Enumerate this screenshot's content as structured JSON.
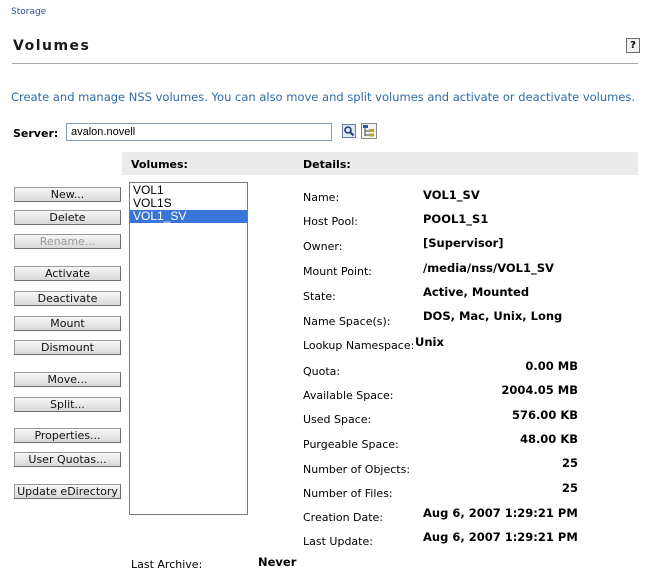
{
  "breadcrumb": "Storage",
  "page_title": "Volumes",
  "help_label": "?",
  "description": "Create and manage NSS volumes. You can also move and split volumes and activate or deactivate volumes.",
  "server": {
    "label": "Server:",
    "value": "avalon.novell"
  },
  "volumes_header": "Volumes:",
  "details_header": "Details:",
  "buttons": {
    "new": "New...",
    "delete": "Delete",
    "rename": "Rename...",
    "activate": "Activate",
    "deactivate": "Deactivate",
    "mount": "Mount",
    "dismount": "Dismount",
    "move": "Move...",
    "split": "Split...",
    "properties": "Properties...",
    "user_quotas": "User Quotas...",
    "update_edirectory": "Update eDirectory"
  },
  "volumes": [
    "VOL1",
    "VOL1S",
    "VOL1_SV"
  ],
  "selected_volume": "VOL1_SV",
  "details": {
    "name": {
      "label": "Name:",
      "value": "VOL1_SV"
    },
    "host_pool": {
      "label": "Host Pool:",
      "value": "POOL1_S1"
    },
    "owner": {
      "label": "Owner:",
      "value": "[Supervisor]"
    },
    "mount_point": {
      "label": "Mount Point:",
      "value": "/media/nss/VOL1_SV"
    },
    "state": {
      "label": "State:",
      "value": "Active, Mounted"
    },
    "name_spaces": {
      "label": "Name Space(s):",
      "value": "DOS, Mac, Unix, Long"
    },
    "lookup_namespace": {
      "label": "Lookup Namespace:",
      "value": "Unix"
    },
    "quota": {
      "label": "Quota:",
      "value": "0.00 MB"
    },
    "available_space": {
      "label": "Available Space:",
      "value": "2004.05 MB"
    },
    "used_space": {
      "label": "Used Space:",
      "value": "576.00 KB"
    },
    "purgeable_space": {
      "label": "Purgeable Space:",
      "value": "48.00 KB"
    },
    "num_objects": {
      "label": "Number of Objects:",
      "value": "25"
    },
    "num_files": {
      "label": "Number of Files:",
      "value": "25"
    },
    "creation_date": {
      "label": "Creation Date:",
      "value": "Aug 6, 2007 1:29:21 PM"
    },
    "last_update": {
      "label": "Last Update:",
      "value": "Aug 6, 2007 1:29:21 PM"
    }
  },
  "last_archive": {
    "label": "Last Archive:",
    "value": "Never"
  },
  "colors": {
    "selection": "#3875d7",
    "link": "#2a4f8f",
    "description": "#2f6aa8",
    "header_bar": "#ebebeb"
  }
}
